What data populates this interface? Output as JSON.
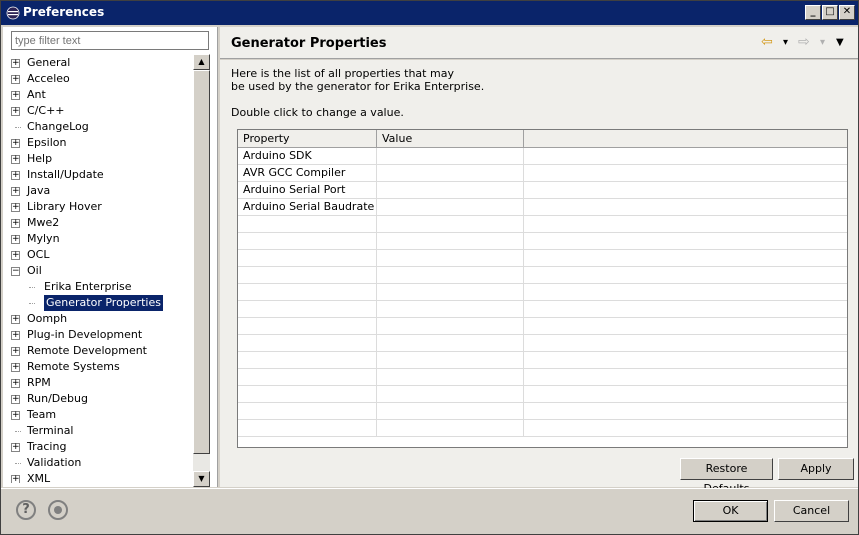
{
  "window": {
    "title": "Preferences",
    "controls": {
      "minimize": "_",
      "maximize": "□",
      "close": "✕"
    }
  },
  "filter": {
    "placeholder": "type filter text"
  },
  "tree": [
    {
      "label": "General",
      "expander": "+"
    },
    {
      "label": "Acceleo",
      "expander": "+"
    },
    {
      "label": "Ant",
      "expander": "+"
    },
    {
      "label": "C/C++",
      "expander": "+"
    },
    {
      "label": "ChangeLog",
      "expander": ""
    },
    {
      "label": "Epsilon",
      "expander": "+"
    },
    {
      "label": "Help",
      "expander": "+"
    },
    {
      "label": "Install/Update",
      "expander": "+"
    },
    {
      "label": "Java",
      "expander": "+"
    },
    {
      "label": "Library Hover",
      "expander": "+"
    },
    {
      "label": "Mwe2",
      "expander": "+"
    },
    {
      "label": "Mylyn",
      "expander": "+"
    },
    {
      "label": "OCL",
      "expander": "+"
    },
    {
      "label": "Oil",
      "expander": "−"
    },
    {
      "label": "Erika Enterprise",
      "expander": "",
      "child": true
    },
    {
      "label": "Generator Properties",
      "expander": "",
      "child": true,
      "selected": true
    },
    {
      "label": "Oomph",
      "expander": "+"
    },
    {
      "label": "Plug-in Development",
      "expander": "+"
    },
    {
      "label": "Remote Development",
      "expander": "+"
    },
    {
      "label": "Remote Systems",
      "expander": "+"
    },
    {
      "label": "RPM",
      "expander": "+"
    },
    {
      "label": "Run/Debug",
      "expander": "+"
    },
    {
      "label": "Team",
      "expander": "+"
    },
    {
      "label": "Terminal",
      "expander": ""
    },
    {
      "label": "Tracing",
      "expander": "+"
    },
    {
      "label": "Validation",
      "expander": ""
    },
    {
      "label": "XML",
      "expander": "+"
    }
  ],
  "page": {
    "title": "Generator Properties",
    "description_line1": "Here is the list of all properties that may",
    "description_line2": "be used by the generator for Erika Enterprise.",
    "instruction": "Double click to change a value."
  },
  "table": {
    "columns": [
      "Property",
      "Value",
      ""
    ],
    "rows": [
      [
        "Arduino SDK",
        "",
        ""
      ],
      [
        "AVR GCC Compiler",
        "",
        ""
      ],
      [
        "Arduino Serial Port",
        "",
        ""
      ],
      [
        "Arduino Serial Baudrate",
        "",
        ""
      ]
    ]
  },
  "buttons": {
    "restore_defaults": "Restore Defaults",
    "apply": "Apply",
    "ok": "OK",
    "cancel": "Cancel"
  },
  "icons": {
    "help": "?",
    "back": "⇦",
    "forward": "⇨",
    "menu": "▼",
    "dropdown": "▾"
  },
  "colors": {
    "titlebar": "#0a246a",
    "selection": "#0a246a",
    "chrome": "#d4d0c8"
  }
}
